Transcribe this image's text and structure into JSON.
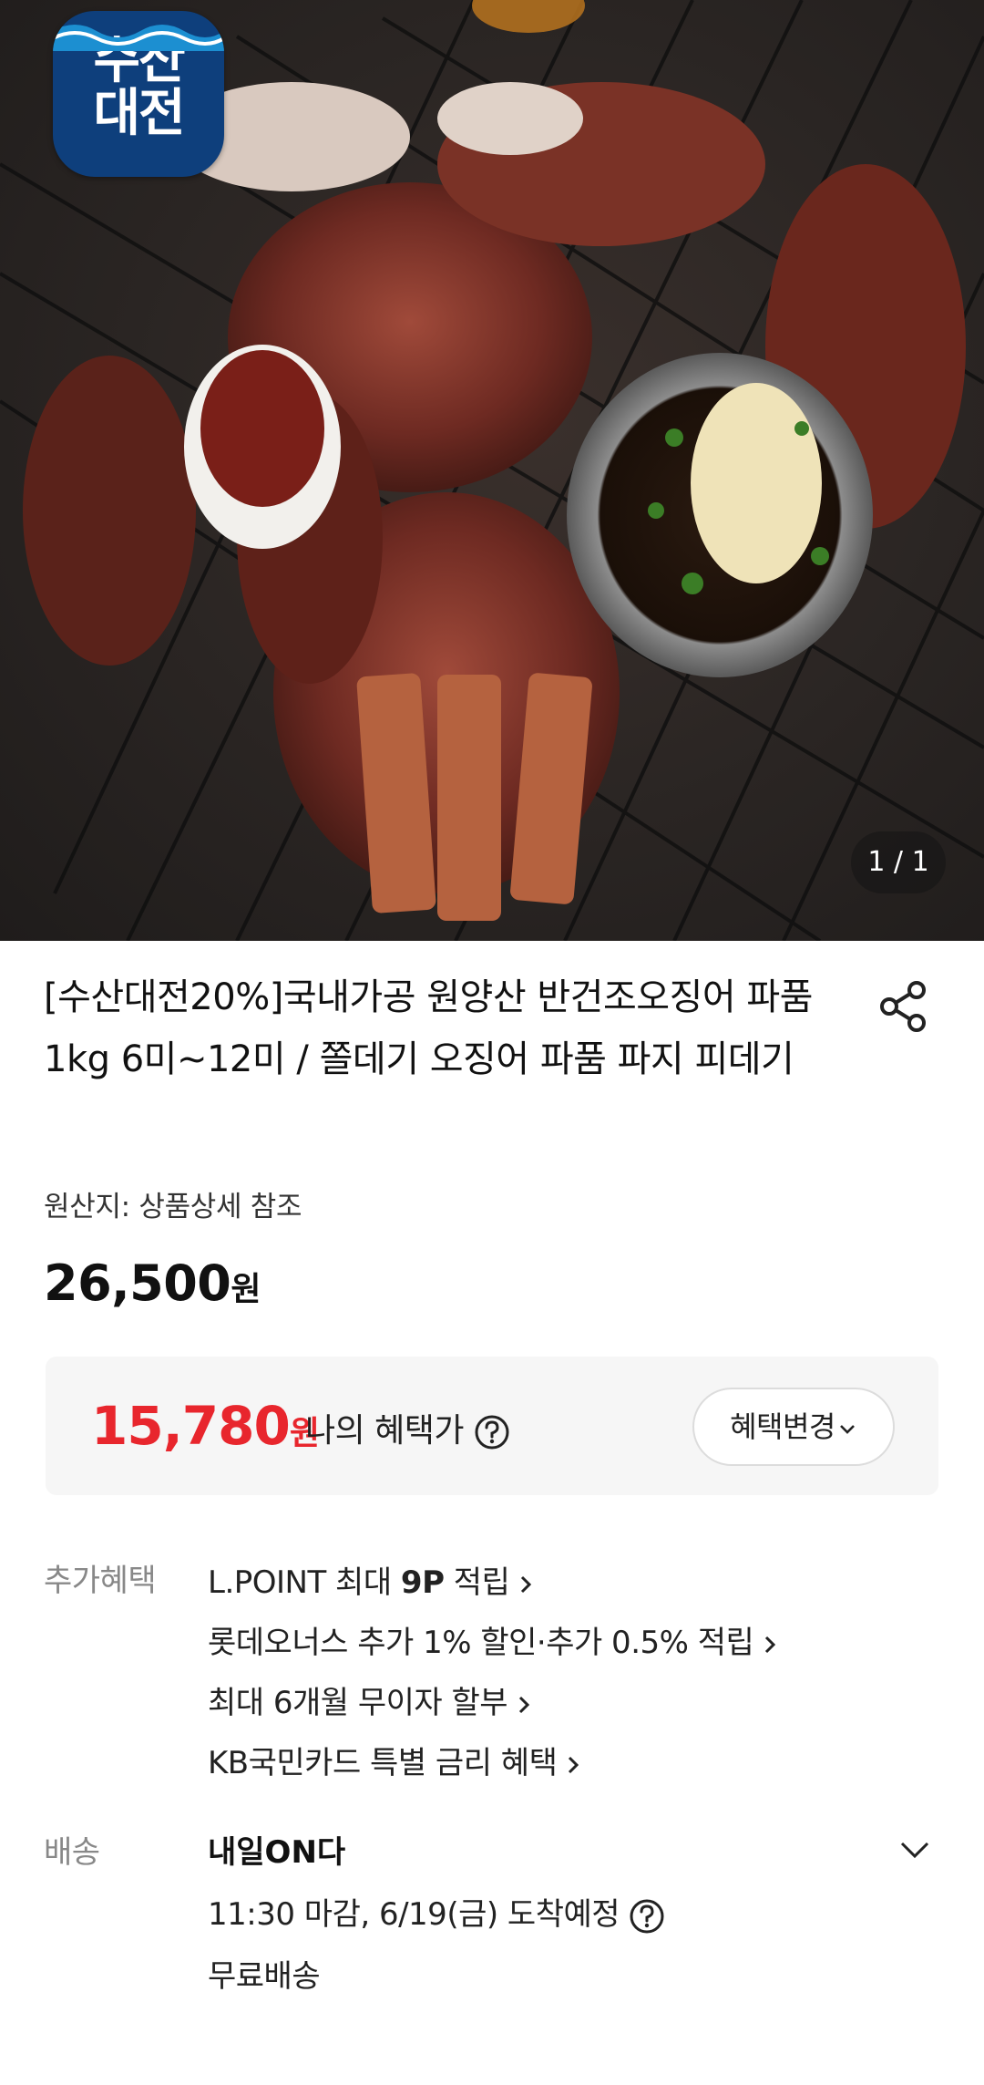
{
  "badge": {
    "text": "수산\n대전"
  },
  "image_counter": "1 / 1",
  "product": {
    "title": "[수산대전20%]국내가공 원양산 반건조오징어 파품1kg 6미~12미 / 쫄데기 오징어 파품 파지 피데기",
    "origin": "원산지: 상품상세 참조",
    "price": "26,500",
    "price_unit": "원"
  },
  "benefit": {
    "price": "15,780",
    "price_unit": "원",
    "label": "나의 혜택가",
    "change_label": "혜택변경"
  },
  "extra_benefits": {
    "label": "추가혜택",
    "items": [
      {
        "prefix": "L.POINT 최대 ",
        "bold": "9P",
        "suffix": " 적립"
      },
      {
        "text": "롯데오너스 추가 1% 할인·추가 0.5% 적립"
      },
      {
        "text": "최대 6개월 무이자 할부"
      },
      {
        "text": "KB국민카드 특별 금리 혜택"
      }
    ]
  },
  "shipping": {
    "label": "배송",
    "title": "내일ON다",
    "deadline": "11:30 마감, 6/19(금) 도착예정",
    "fee": "무료배송"
  },
  "colors": {
    "accent_red": "#e8262d",
    "badge_blue": "#0e3f7c",
    "box_bg": "#f6f6f6"
  },
  "icons": [
    "share-icon",
    "question-circle-icon",
    "chevron-down-icon",
    "chevron-right-icon"
  ]
}
